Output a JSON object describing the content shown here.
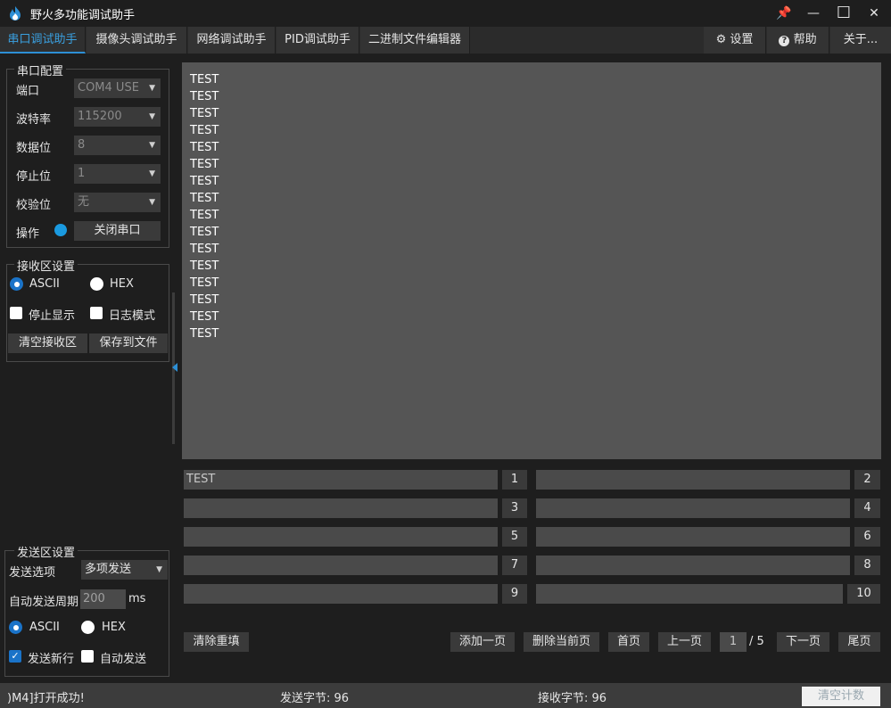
{
  "app": {
    "title": "野火多功能调试助手"
  },
  "window_controls": {
    "pin": "📌",
    "min": "—",
    "max": "☐",
    "close": "✕"
  },
  "tabs": [
    {
      "label": "串口调试助手"
    },
    {
      "label": "摄像头调试助手"
    },
    {
      "label": "网络调试助手"
    },
    {
      "label": "PID调试助手"
    },
    {
      "label": "二进制文件编辑器"
    }
  ],
  "right_tabs": {
    "settings": "设置",
    "help": "帮助",
    "about": "关于..."
  },
  "serial_config": {
    "title": "串口配置",
    "port_label": "端口",
    "port_value": "COM4 USE",
    "baud_label": "波特率",
    "baud_value": "115200",
    "data_label": "数据位",
    "data_value": "8",
    "stop_label": "停止位",
    "stop_value": "1",
    "parity_label": "校验位",
    "parity_value": "无",
    "op_label": "操作",
    "close_port": "关闭串口"
  },
  "receive_settings": {
    "title": "接收区设置",
    "ascii": "ASCII",
    "hex": "HEX",
    "stop_display": "停止显示",
    "log_mode": "日志模式",
    "clear": "清空接收区",
    "save": "保存到文件"
  },
  "receive_area": {
    "lines": [
      "TEST",
      "TEST",
      "TEST",
      "TEST",
      "TEST",
      "TEST",
      "TEST",
      "TEST",
      "TEST",
      "TEST",
      "TEST",
      "TEST",
      "TEST",
      "TEST",
      "TEST",
      "TEST"
    ]
  },
  "send_settings": {
    "title": "发送区设置",
    "option_label": "发送选项",
    "option_value": "多项发送",
    "period_label": "自动发送周期",
    "period_value": "200",
    "period_unit": "ms",
    "ascii": "ASCII",
    "hex": "HEX",
    "newline": "发送新行",
    "auto_send": "自动发送"
  },
  "send_fields": [
    {
      "value": "TEST",
      "num": "1"
    },
    {
      "value": "",
      "num": "2"
    },
    {
      "value": "",
      "num": "3"
    },
    {
      "value": "",
      "num": "4"
    },
    {
      "value": "",
      "num": "5"
    },
    {
      "value": "",
      "num": "6"
    },
    {
      "value": "",
      "num": "7"
    },
    {
      "value": "",
      "num": "8"
    },
    {
      "value": "",
      "num": "9"
    },
    {
      "value": "",
      "num": "10"
    }
  ],
  "bottom_buttons": {
    "clear_refill": "清除重填",
    "add_page": "添加一页",
    "delete_page": "删除当前页",
    "first": "首页",
    "prev": "上一页",
    "page_current": "1",
    "page_total": "/ 5",
    "next": "下一页",
    "last": "尾页"
  },
  "status": {
    "message": ")M4]打开成功!",
    "sent": "发送字节: 96",
    "received": "接收字节: 96",
    "clear_count": "清空计数"
  },
  "colors": {
    "accent": "#2d8fd5",
    "port_status": "#1a9ae0"
  }
}
